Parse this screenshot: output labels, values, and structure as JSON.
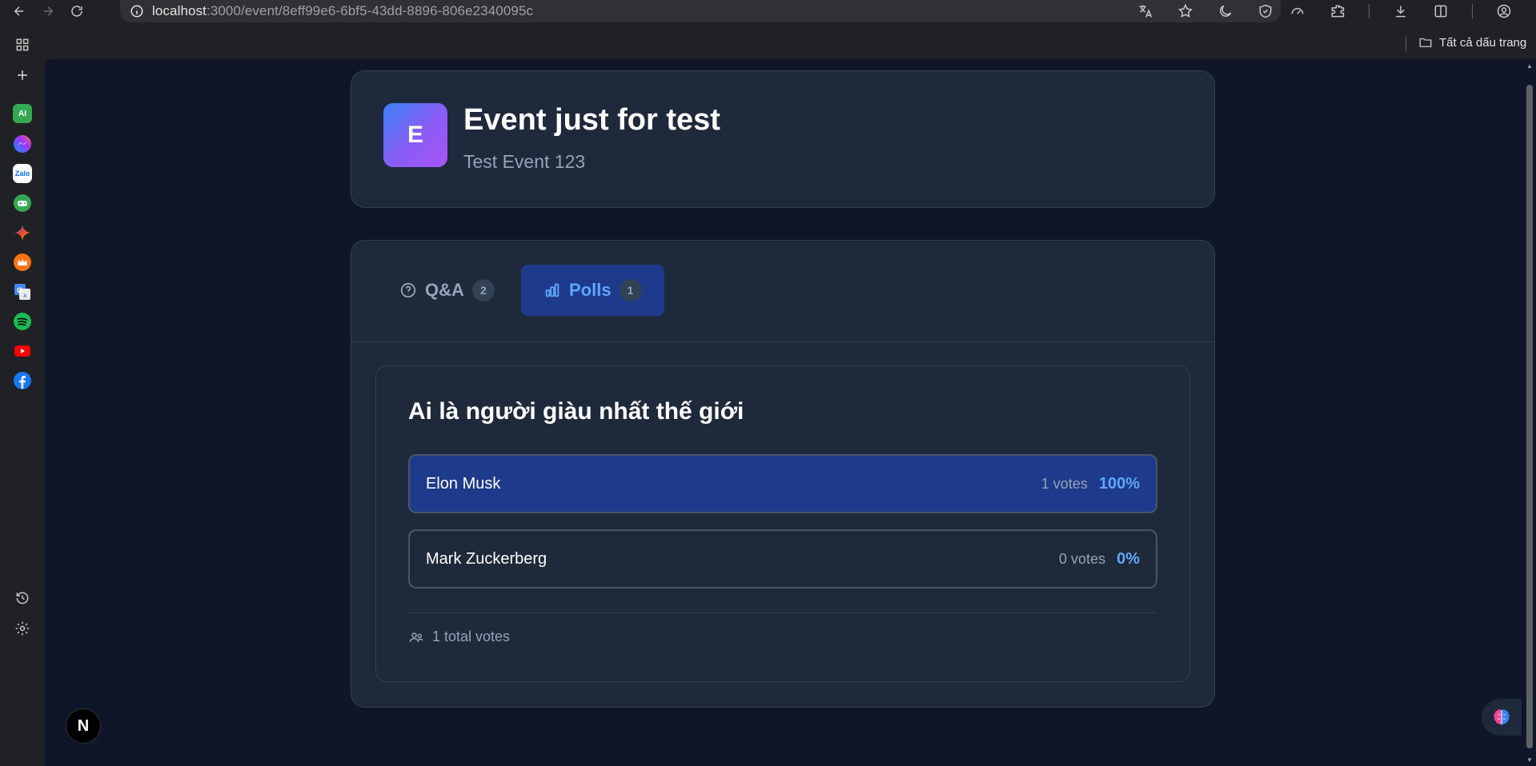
{
  "browser": {
    "url_host": "localhost",
    "url_path": ":3000/event/8eff99e6-6bf5-43dd-8896-806e2340095c",
    "bookmarks_label": "Tất cả dấu trang"
  },
  "sidebar": {
    "apps": [
      {
        "name": "AI",
        "color": "#34a853"
      },
      {
        "name": "Messenger",
        "color": "#a855f7"
      },
      {
        "name": "Zalo",
        "color": "#0068ff"
      },
      {
        "name": "Game",
        "color": "#34a853"
      },
      {
        "name": "Gemini",
        "color": "#4285f4"
      },
      {
        "name": "Crown",
        "color": "#f97316"
      },
      {
        "name": "Translate",
        "color": "#4285f4"
      },
      {
        "name": "Spotify",
        "color": "#1db954"
      },
      {
        "name": "YouTube",
        "color": "#ff0000"
      },
      {
        "name": "Facebook",
        "color": "#1877f2"
      }
    ],
    "zalo_label": "Zalo",
    "ai_label": "AI"
  },
  "event": {
    "avatar_letter": "E",
    "title": "Event just for test",
    "subtitle": "Test Event 123"
  },
  "tabs": [
    {
      "label": "Q&A",
      "count": "2",
      "active": false
    },
    {
      "label": "Polls",
      "count": "1",
      "active": true
    }
  ],
  "poll": {
    "question": "Ai là người giàu nhất thế giới",
    "options": [
      {
        "label": "Elon Musk",
        "votes": "1 votes",
        "percent": "100%",
        "selected": true
      },
      {
        "label": "Mark Zuckerberg",
        "votes": "0 votes",
        "percent": "0%",
        "selected": false
      }
    ],
    "total": "1 total votes"
  },
  "overlay": {
    "next_letter": "N"
  },
  "colors": {
    "page_bg": "#0f1629",
    "card_bg": "#1e293b",
    "accent": "#60a5fa",
    "active_tab_bg": "#1e3a8a"
  }
}
